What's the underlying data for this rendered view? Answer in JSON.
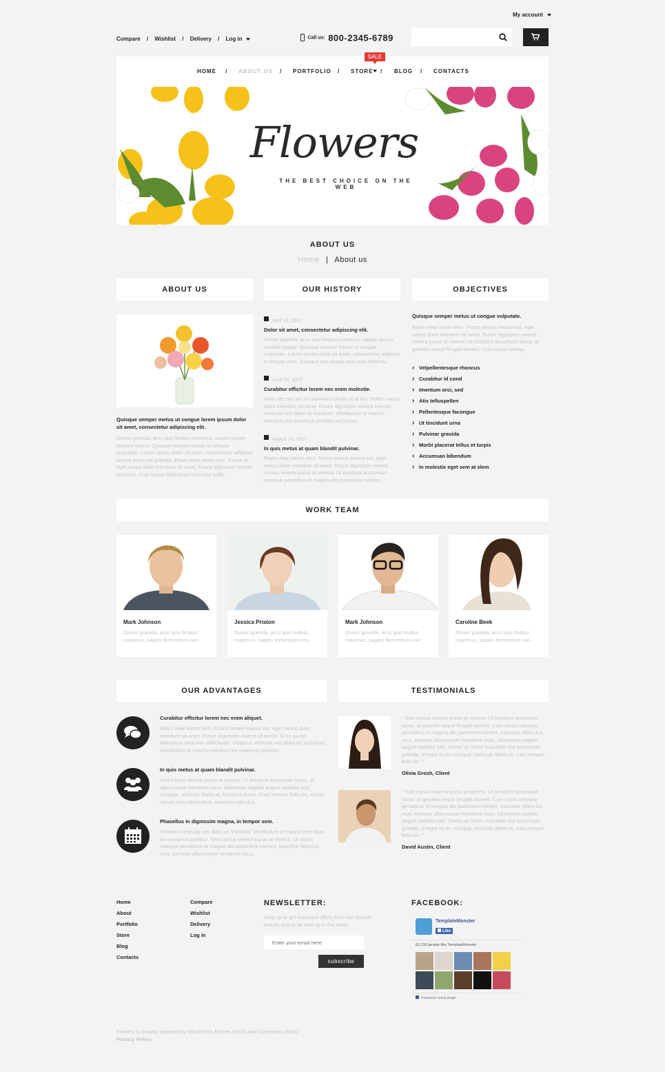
{
  "header": {
    "my_account": "My account",
    "top_links": [
      "Compare",
      "Wishlist",
      "Delivery",
      "Log in"
    ],
    "call_us_label": "Call us:",
    "phone": "800-2345-6789"
  },
  "nav": {
    "items": [
      "HOME",
      "ABOUT US",
      "PORTFOLIO",
      "STORE",
      "BLOG",
      "CONTACTS"
    ],
    "sale_badge": "SALE"
  },
  "banner": {
    "title": "Flowers",
    "tagline": "THE BEST CHOICE ON THE WEB"
  },
  "page": {
    "title": "ABOUT US",
    "breadcrumb_home": "Home",
    "breadcrumb_sep": "|",
    "breadcrumb_current": "About us"
  },
  "about": {
    "head": "ABOUT US",
    "bold": "Quisque semper metus ut congue lorem ipsum dolor sit amet, consectetur adipiscing elit.",
    "text": "Donec gravida, arcu quis finibus maximus, sapien ipsum facilisis neque. Quisque semper metus ut congue vulputate. Lorem ipsum dolor sit amet, consectetur adipisce ornare lacus vel gravida. Etiam vitae lorem sem. Fusce at, eget varius diam interdum sit amet. Fusce dignissim viverra pharetra. Cras auctor bibendum urna non sollic."
  },
  "history": {
    "head": "OUR HISTORY",
    "entries": [
      {
        "date": "April 16, 2012",
        "title": "Dolor sit amet, consectetur adipiscing elit.",
        "text": "Donec gravida, arcu quis finibus maximus, sapien ipsum facilisis neque. Quisque semper metus ut congue vulputate. Lorem ipsum dolor sit amet, consectetur adipisce in tempor sem. Quisque nec neque non nulla bibendu."
      },
      {
        "date": "June 16, 2013",
        "title": "Curabitur efficitur lorem nec enim molestie.",
        "text": "Nam nec nisi vel mi maximus rutrum at at leo. Pellen varius diam interdum sit amet. Fusce dignissim viverra ivamus vehicula nec diam ac tincidunt. Vestibulum ut mauris interdum leo maximus porttitor sed cursu."
      },
      {
        "date": "August 16, 2015",
        "title": "In quis metus at quam blandit pulvinar.",
        "text": "Etiam vitae lorem sem. Fusce ornare massa est, eget varius diam interdum sit amet. Fusce dignissim viverra cursus viverra purus at viverra. Ut tincidunt accumsan natoque penatibus et magnis dis parturient montes."
      }
    ]
  },
  "objectives": {
    "head": "OBJECTIVES",
    "bold": "Quisque semper metus ut congue vulputate.",
    "text": "Etiam vitae lorem sem. Fusce ornare massa est, eget varius diam interdum sit amet. Fusce dignissim viverra viverra purus at viverra. Ut tincidunt accumsan lacus, at gravida neque feugiat laoreet. Cum sociis natoqu.",
    "list": [
      "Velpellentesque rhoncus",
      "Curabitur id cond",
      "Imentum orci, sed",
      "Atis telluspellen",
      "Pellentesque facongue",
      "Ut tincidunt urna",
      "Pulvinar gravida",
      "Morbi placerat tellus et turpis",
      "Accumsan bibendum",
      "In molestie eget sem at elem"
    ]
  },
  "team": {
    "head": "WORK TEAM",
    "members": [
      {
        "name": "Mark Johnson",
        "text": "Donec gravida, arcu quis finibus maximus, sapien fermentum con."
      },
      {
        "name": "Jessica Priston",
        "text": "Donec gravida, arcu quis finibus maximus, sapien fermentum con."
      },
      {
        "name": "Mark Johnson",
        "text": "Donec gravida, arcu quis finibus maximus, sapien fermentum con."
      },
      {
        "name": "Caroline Beek",
        "text": "Donec gravida, arcu quis finibus maximus, sapien fermentum con."
      }
    ]
  },
  "advantages": {
    "head": "OUR ADVANTAGES",
    "items": [
      {
        "icon": "chat-bubbles-icon",
        "title": "Curabitur efficitur lorem nec enim aliquet.",
        "text": "Etiam vitae lorem sem. Fusce ornare massa est, eget varius diam interdum sit amet. Fusce dignissim viverra pharetra. Cras auctor bibendum urna non sollicitudin. Vivamus vehicula nec diam ac tinci-dunt. Vestibulum ut mauris interdum leo maximus porttitor."
      },
      {
        "icon": "group-icon",
        "title": "In quis metus at quam blandit pulvinar.",
        "text": "Sed cursus viverra purus at viverra. Ut tincidunt accumsan lacus, at ullamcorper hendrerit risus, bibendum sagittis augue sodales sed. volutpat, vehicula libero at, tincidunt purus. Cras semper felis nis, auctor rutrum arcu eleifend et, nascetur ridiculus."
      },
      {
        "icon": "calendar-icon",
        "title": "Phasellus in dignissim magna, in tempor sem.",
        "text": "Vivamus vehicula nec diam ac tincidunt. Vestibulum ut mauris inter-dum leo maximus porttitor. Sed cursus viverra purus at viverra. Ut sociis natoque penatibus et magnis dis parturient montes, nascetur ridiculus mus. Aenean ullamcorper hendrerit risus."
      }
    ]
  },
  "testimonials": {
    "head": "TESTIMONIALS",
    "items": [
      {
        "text": "\" Sed cursus viverra purus at viverra. Ut tincidunt accumsan lacus, at gravida neque feugiat laoreet. Cum sociis natoque penatibus et magnis dis parturient montes, nascetur ridicu-lus mus. Aenean ullamcorper hendrerit risus, bibendum sagittis augue sodales sed. Donec ac tortor vulputate nisl accumsan gravida. Integer eu ex volutpat, vehicula libero at, cras semper felis nis. \"",
        "author": "Olivia Grosh, Client"
      },
      {
        "text": "\" Sed cursus viverra purus at viverra. Ut tincidunt accumsan lacus, at gravida neque feugiat laoreet. Cum sociis natoque penatibus et magnis dis parturient montes, nascetur ridicu-lus mus. Aenean ullamcorper hendrerit risus, bibendum sagittis augue sodales sed. Donec ac tortor vulputate nisl accumsan gravida. Integer eu ex volutpat, vehicula libero at, cras semper felis nis. \"",
        "author": "David Austin, Client"
      }
    ]
  },
  "footer": {
    "col1": [
      "Home",
      "About",
      "Portfolio",
      "Store",
      "Blog",
      "Contacts"
    ],
    "col2": [
      "Compare",
      "Wishlist",
      "Delivery",
      "Log in"
    ],
    "newsletter_head": "NEWSLETTER:",
    "newsletter_text": "Sing up to get exclusive offers from our favorite brands and to be well up in the news.",
    "email_placeholder": "Enter your email here",
    "subscribe": "subscribe",
    "facebook_head": "FACEBOOK:",
    "fb_page": "TemplateMonster",
    "fb_like": "Like",
    "fb_count": "63,318 people like TemplateMonster.",
    "fb_plugin": "Facebook social plugin",
    "copyright": "Flowers is proudly powered by WordPress Entries (RSS) and Comments (RSS)",
    "privacy": "Privacy Policy"
  }
}
